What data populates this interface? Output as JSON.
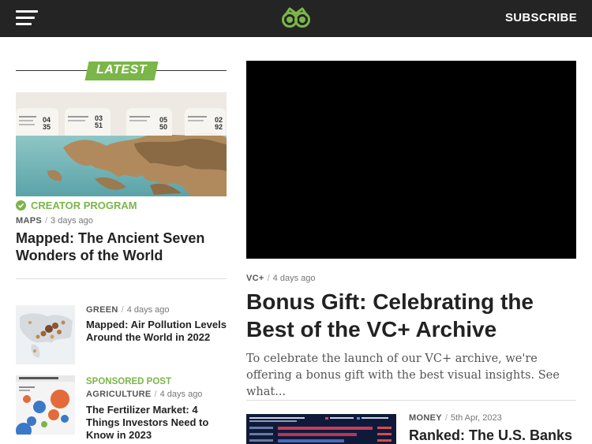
{
  "header": {
    "menu_icon": "hamburger-menu-icon",
    "logo_icon": "visual-capitalist-logo",
    "subscribe_label": "SUBSCRIBE"
  },
  "latest": {
    "tag": "LATEST",
    "feature": {
      "badge": "CREATOR PROGRAM",
      "category": "MAPS",
      "date": "3 days ago",
      "title": "Mapped: The Ancient Seven Wonders of the World"
    },
    "items": [
      {
        "category": "GREEN",
        "date": "4 days ago",
        "title": "Mapped: Air Pollution Levels Around the World in 2022"
      },
      {
        "badge": "SPONSORED POST",
        "category": "AGRICULTURE",
        "date": "4 days ago",
        "title": "The Fertilizer Market: 4 Things Investors Need to Know in 2023"
      }
    ]
  },
  "main": {
    "category": "VC+",
    "date": "4 days ago",
    "title": "Bonus Gift: Celebrating the Best of the VC+ Archive",
    "excerpt": "To celebrate the launch of our VC+ archive, we're offering a bonus gift with the best visual insights. See what..."
  },
  "secondary": {
    "category": "MONEY",
    "date": "5th Apr, 2023",
    "title": "Ranked: The U.S. Banks"
  },
  "map_labels": {
    "wonders": [
      {
        "name": "Statue of Zeus",
        "a": "04",
        "b": "35"
      },
      {
        "name": "Mausoleum",
        "a": "03",
        "b": "51"
      },
      {
        "name": "Temple of Artemis",
        "a": "05",
        "b": "50"
      },
      {
        "name": "Colossus of Rhodes",
        "a": "02",
        "b": "92"
      }
    ]
  },
  "colors": {
    "accent": "#7ab648",
    "topbar": "#242424"
  }
}
